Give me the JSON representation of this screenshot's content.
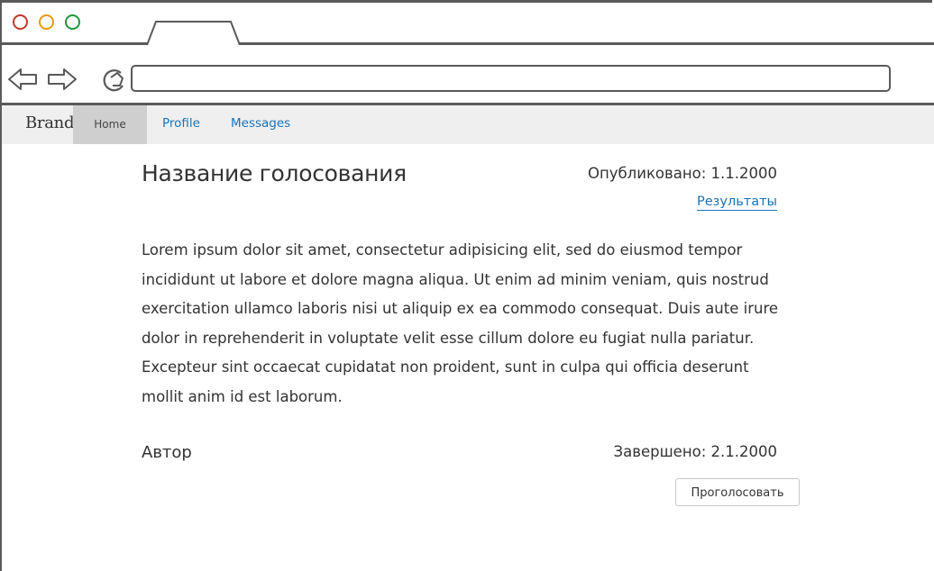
{
  "navbar": {
    "brand": "Brand",
    "items": [
      {
        "label": "Home",
        "active": true
      },
      {
        "label": "Profile",
        "active": false
      },
      {
        "label": "Messages",
        "active": false
      }
    ]
  },
  "poll": {
    "title": "Название голосования",
    "published_label": "Опубликовано: 1.1.2000",
    "results_link": "Результаты",
    "description": "Lorem ipsum dolor sit amet, consectetur adipisicing elit, sed do eiusmod tempor incididunt ut labore et dolore magna aliqua. Ut enim ad minim veniam, quis nostrud exercitation ullamco laboris nisi ut aliquip ex ea commodo consequat. Duis aute irure dolor in reprehenderit in voluptate velit esse cillum dolore eu fugiat nulla pariatur. Excepteur sint occaecat cupidatat non proident, sunt in culpa qui officia deserunt mollit anim id est laborum.",
    "author": "Автор",
    "completed_label": "Завершено: 2.1.2000",
    "vote_button": "Проголосовать"
  },
  "browser": {
    "url": "",
    "icons": [
      "back-arrow-icon",
      "forward-arrow-icon",
      "reload-icon"
    ],
    "window_controls": [
      "close-dot",
      "minimize-dot",
      "maximize-dot"
    ]
  },
  "colors": {
    "link": "#1a73b8",
    "nav_background": "#efefef",
    "nav_active": "#cfcfcf",
    "close": "#c0392b",
    "minimize": "#e69a0f",
    "maximize": "#1e9a3a"
  }
}
